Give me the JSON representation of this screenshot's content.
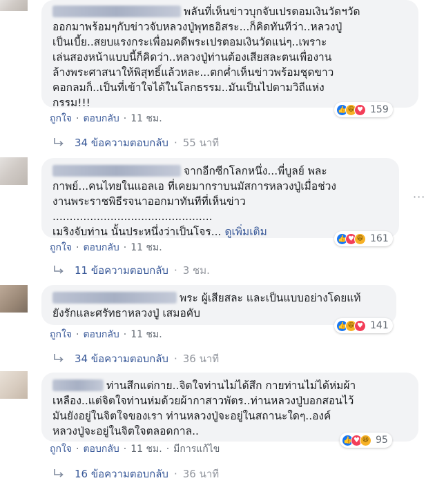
{
  "comments": [
    {
      "text": "พลันที่เห็นข่าวบุกจับเปรตอมเงินวัดฯวัดออกมาพร้อมๆกับข่าวจับหลวงปู่พุทธอิสระ...ก็คิดทันทีว่า..หลวงปู่เป็นเบี้ย..สยบแรงกระเพื่อมคดีพระเปรตอมเงินวัดแน่ๆ..เพราะเล่นสองหน้าแบบนี้ก็คิดว่า..หลวงปู่ท่านต้องเสียสละตนเพื่องานล้างพระศาสนาให้พิสุทธิ์แล้วหละ...ตกค่ำเห็นข่าวพร้อมชุดขาวคอกลมก็..เป็นที่เข้าใจได้ในโลกธรรม..มันเป็นไปตามวิถีแห่งกรรม!!!",
      "lines": [
        "พลันที่เห็นข่าวบุกจับเปรตอมเงินวัดฯวัด",
        "ออกมาพร้อมๆกับข่าวจับหลวงปู่พุทธอิสระ...ก็คิดทันทีว่า..หลวงปู่",
        "เป็นเบี้ย..สยบแรงกระเพื่อมคดีพระเปรตอมเงินวัดแน่ๆ..เพราะ",
        "เล่นสองหน้าแบบนี้ก็คิดว่า..หลวงปู่ท่านต้องเสียสละตนเพื่องาน",
        "ล้างพระศาสนาให้พิสุทธิ์แล้วหละ...ตกค่ำเห็นข่าวพร้อมชุดขาว",
        "คอกลมก็..เป็นที่เข้าใจได้ในโลกธรรม..มันเป็นไปตามวิถีแห่ง",
        "กรรม!!!"
      ],
      "reactions": [
        "like",
        "haha",
        "love"
      ],
      "count": "159",
      "like": "ถูกใจ",
      "reply": "ตอบกลับ",
      "time": "11 ชม.",
      "replies": "34 ข้อความตอบกลับ",
      "replies_time": "55 นาที"
    },
    {
      "lines": [
        "จากอีกซีกโลกหนึ่ง...พี่บูลย์ พละ",
        "กาพย์...คนไทยในแอลเอ ที่เคยมากราบนมัสการหลวงปู่เมื่อช่วง",
        "งานพระราชพิธีรจนาออกมาทันทีที่เห็นข่าว",
        "...............................................",
        "เมริงจับท่าน นั้นประหนึ่งว่าเป็นโจร..."
      ],
      "see_more": "ดูเพิ่มเติม",
      "reactions": [
        "like",
        "love",
        "haha"
      ],
      "count": "161",
      "like": "ถูกใจ",
      "reply": "ตอบกลับ",
      "time": "11 ชม.",
      "replies": "11 ข้อความตอบกลับ",
      "replies_time": "3 ชม."
    },
    {
      "lines": [
        "พระ ผู้เสียสละ และเป็นแบบอย่างโดยแท้",
        "ยังรักและศรัทธาหลวงปู่ เสมอคับ"
      ],
      "reactions": [
        "like",
        "haha",
        "love"
      ],
      "count": "141",
      "like": "ถูกใจ",
      "reply": "ตอบกลับ",
      "time": "11 ชม.",
      "replies": "34 ข้อความตอบกลับ",
      "replies_time": "36 นาที"
    },
    {
      "lines": [
        "ท่านสึกแต่กาย..จิตใจท่านไม่ได้สึก กายท่านไม่ได้ห่มผ้า",
        "เหลือง..แต่จิตใจท่านห่มด้วยผ้ากาสาวพัตร..ท่านหลวงปู่บอกสอนไว้",
        "มันยังอยู่ในจิตใจของเรา ท่านหลวงปู่จะอยู่ในสถานะใดๆ..องค์",
        "หลวงปู่จะอยู่ในจิตใจตลอดกาล.."
      ],
      "reactions": [
        "like",
        "love",
        "haha"
      ],
      "count": "95",
      "like": "ถูกใจ",
      "reply": "ตอบกลับ",
      "time": "11 ชม.",
      "edited": "มีการแก้ไข",
      "replies": "16 ข้อความตอบกลับ",
      "replies_time": "36 นาที"
    }
  ],
  "menu_dots": "···",
  "colors": {
    "link": "#385898",
    "bubble": "#f2f3f5",
    "meta": "#606770",
    "like": "#1877f2",
    "love": "#f33e58",
    "haha": "#f7b125"
  },
  "icons": {
    "like": "thumbs-up-icon",
    "love": "heart-icon",
    "haha": "laughing-face-icon",
    "reply_arrow": "reply-arrow-icon"
  }
}
